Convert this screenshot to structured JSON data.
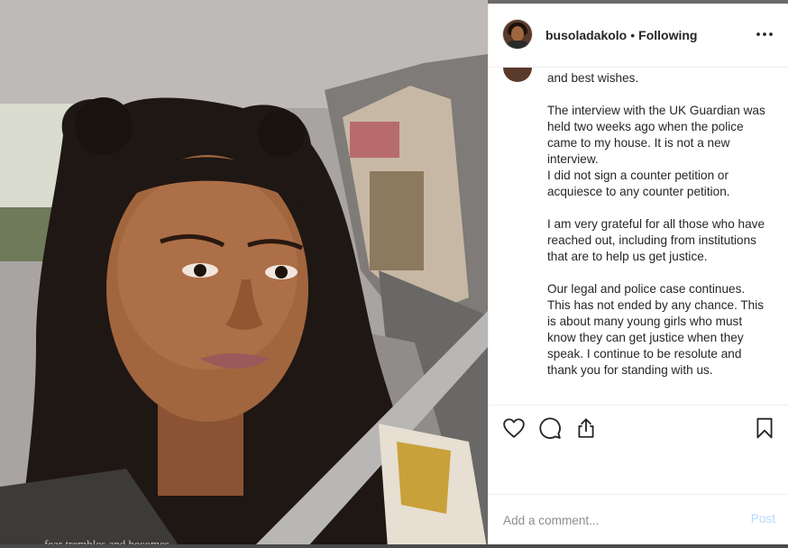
{
  "post": {
    "username": "busoladakolo",
    "separator": "•",
    "follow_status": "Following",
    "more_icon": "more-horizontal-icon"
  },
  "caption": {
    "paragraphs": [
      "and best wishes.",
      "The interview with the UK Guardian was held two weeks ago when the police came to my house. It is not a new interview.\nI did not sign a counter petition or acquiesce to any counter petition.",
      "I am very grateful for all those who have reached out, including from institutions that are to help us get justice.",
      "Our legal and police case continues. This has not ended by any chance. This is about many young girls who must know they can get justice when they speak. I continue to be resolute and thank you for standing with us."
    ]
  },
  "actions": {
    "like_icon": "heart-icon",
    "comment_icon": "comment-bubble-icon",
    "share_icon": "share-icon",
    "save_icon": "bookmark-icon"
  },
  "comment_box": {
    "placeholder": "Add a comment...",
    "post_label": "Post"
  },
  "photo_overlay_text": "fear trembles and becomes",
  "colors": {
    "text": "#262626",
    "muted": "#8e8e8e",
    "post_disabled": "#b3dbff",
    "divider": "#efefef"
  }
}
